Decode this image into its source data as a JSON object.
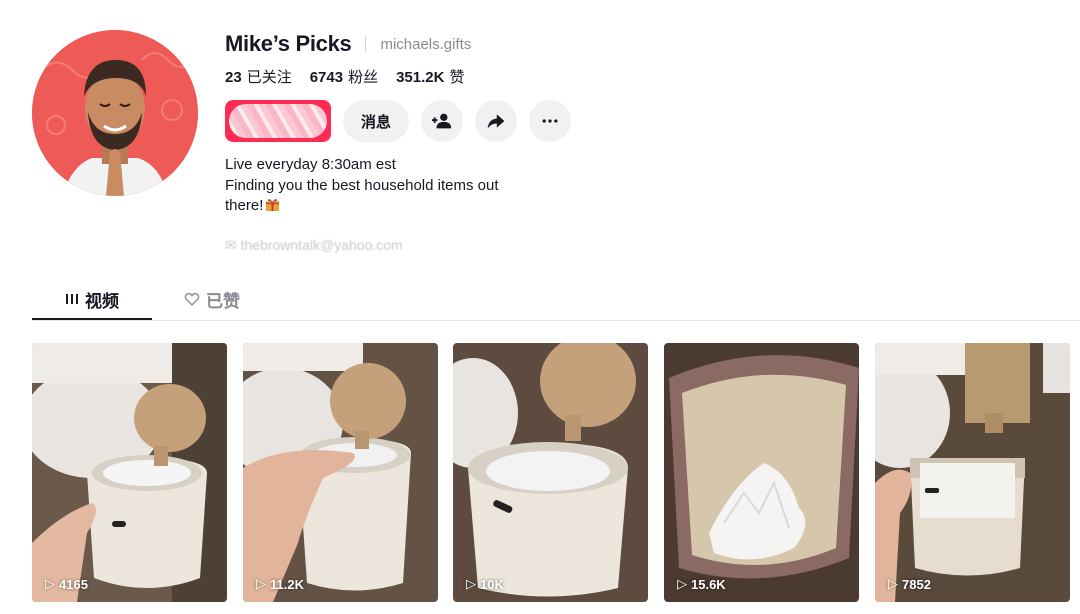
{
  "profile": {
    "name": "Mike’s Picks",
    "handle": "michaels.gifts",
    "stats": [
      {
        "value": "23",
        "label": "已关注"
      },
      {
        "value": "6743",
        "label": "粉丝"
      },
      {
        "value": "351.2K",
        "label": "赞"
      }
    ],
    "message_label": "消息",
    "bio_lines": [
      "Live everyday 8:30am est",
      "Finding you the best household items out",
      "there!"
    ],
    "email": "thebrowntalk@yahoo.com"
  },
  "tabs": [
    {
      "label": "视频",
      "icon": "grid-icon",
      "active": true
    },
    {
      "label": "已赞",
      "icon": "heart-icon",
      "active": false
    }
  ],
  "videos": [
    {
      "views": "4165"
    },
    {
      "views": "11.2K"
    },
    {
      "views": "10K"
    },
    {
      "views": "15.6K"
    },
    {
      "views": "7852"
    }
  ],
  "colors": {
    "accent": "#fe2c55",
    "text": "#161823",
    "muted": "#8a8b91",
    "avatar_bg": "#ee5b57"
  }
}
